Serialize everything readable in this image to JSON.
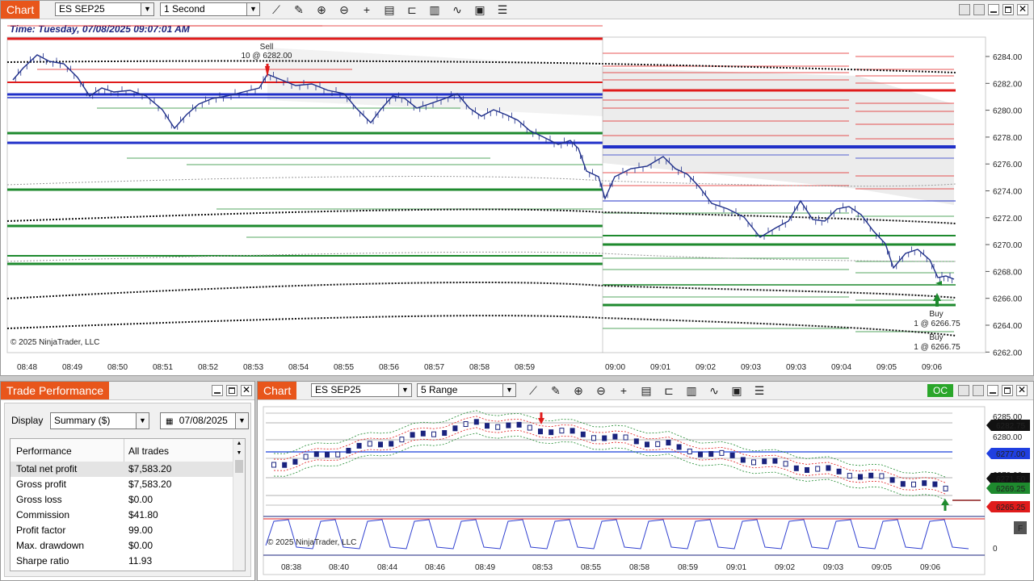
{
  "top_chart": {
    "title": "Chart",
    "instrument": "ES SEP25",
    "interval": "1 Second",
    "time_label": "Time: Tuesday, 07/08/2025 09:07:01 AM",
    "copyright": "© 2025 NinjaTrader, LLC",
    "y_ticks": [
      "6284.00",
      "6282.00",
      "6280.00",
      "6278.00",
      "6276.00",
      "6274.00",
      "6272.00",
      "6270.00",
      "6268.00",
      "6266.00",
      "6264.00",
      "6262.00"
    ],
    "x_ticks": [
      "08:48",
      "08:49",
      "08:50",
      "08:51",
      "08:52",
      "08:53",
      "08:54",
      "08:55",
      "08:56",
      "08:57",
      "08:58",
      "08:59",
      "09:00",
      "09:01",
      "09:02",
      "09:03",
      "09:03",
      "09:04",
      "09:05",
      "09:06"
    ],
    "sell_label": "Sell",
    "sell_detail": "10 @ 6282.00",
    "buy1_label": "Buy",
    "buy1_detail": "1 @ 6266.75",
    "buy2_label": "Buy",
    "buy2_detail": "1 @ 6266.75",
    "toolbar_icons": [
      "line-draw-icon",
      "pencil-icon",
      "zoom-in-icon",
      "zoom-out-icon",
      "crosshair-icon",
      "properties-icon",
      "strategy-icon",
      "bar-type-icon",
      "indicator-icon",
      "template-icon",
      "list-icon"
    ]
  },
  "trade_performance": {
    "title": "Trade Performance",
    "display_label": "Display",
    "display_value": "Summary ($)",
    "date_value": "07/08/2025",
    "col_performance": "Performance",
    "col_all_trades": "All trades",
    "rows": [
      {
        "label": "Total net profit",
        "value": "$7,583.20"
      },
      {
        "label": "Gross profit",
        "value": "$7,583.20"
      },
      {
        "label": "Gross loss",
        "value": "$0.00"
      },
      {
        "label": "Commission",
        "value": "$41.80"
      },
      {
        "label": "Profit factor",
        "value": "99.00"
      },
      {
        "label": "Max. drawdown",
        "value": "$0.00"
      },
      {
        "label": "Sharpe ratio",
        "value": "11.93"
      }
    ]
  },
  "bottom_chart": {
    "title": "Chart",
    "instrument": "ES SEP25",
    "interval": "5 Range",
    "oc_label": "OC",
    "copyright": "© 2025 NinjaTrader, LLC",
    "y_ticks": [
      "6285.00",
      "6280.00",
      "6275.00",
      "6270.00"
    ],
    "price_tags": [
      {
        "text": "6282.75",
        "color": "#111111"
      },
      {
        "text": "6277.00",
        "color": "#1f3fe0"
      },
      {
        "text": "6271.50",
        "color": "#111111"
      },
      {
        "text": "6269.25",
        "color": "#1e8a2e"
      },
      {
        "text": "6265.25",
        "color": "#e01b1b"
      }
    ],
    "osc_tick": "0",
    "x_ticks": [
      "08:38",
      "08:40",
      "08:44",
      "08:46",
      "08:49",
      "08:53",
      "08:55",
      "08:58",
      "08:59",
      "09:01",
      "09:02",
      "09:03",
      "09:05",
      "09:06"
    ],
    "panel_icon": "F"
  },
  "colors": {
    "accent": "#e8561b",
    "price_line": "#1f2f8a",
    "sell": "#e01b1b",
    "buy": "#1e8a2e"
  }
}
